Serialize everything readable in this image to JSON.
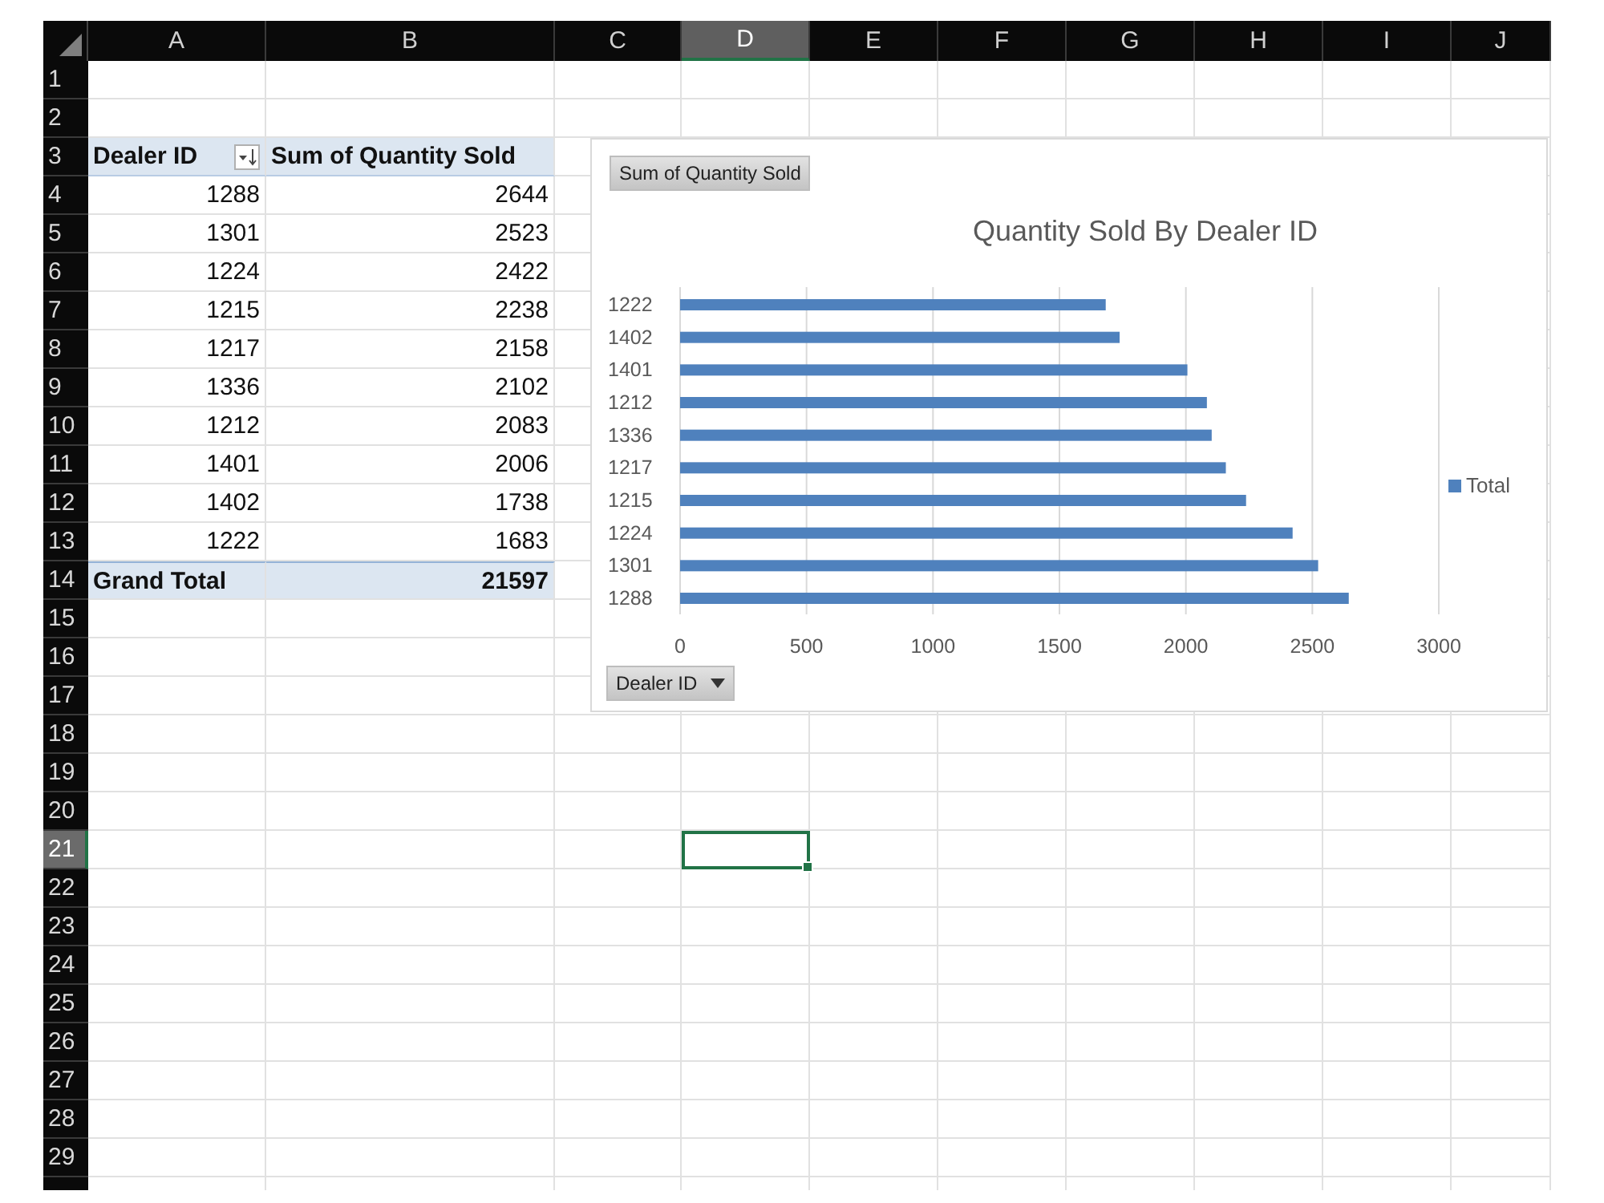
{
  "column_headers": [
    {
      "label": "A",
      "selected": false
    },
    {
      "label": "B",
      "selected": false
    },
    {
      "label": "C",
      "selected": false
    },
    {
      "label": "D",
      "selected": true
    },
    {
      "label": "E",
      "selected": false
    },
    {
      "label": "F",
      "selected": false
    },
    {
      "label": "G",
      "selected": false
    },
    {
      "label": "H",
      "selected": false
    },
    {
      "label": "I",
      "selected": false
    },
    {
      "label": "J",
      "selected": false
    }
  ],
  "row_headers": [
    {
      "label": "1",
      "selected": false
    },
    {
      "label": "2",
      "selected": false
    },
    {
      "label": "3",
      "selected": false
    },
    {
      "label": "4",
      "selected": false
    },
    {
      "label": "5",
      "selected": false
    },
    {
      "label": "6",
      "selected": false
    },
    {
      "label": "7",
      "selected": false
    },
    {
      "label": "8",
      "selected": false
    },
    {
      "label": "9",
      "selected": false
    },
    {
      "label": "10",
      "selected": false
    },
    {
      "label": "11",
      "selected": false
    },
    {
      "label": "12",
      "selected": false
    },
    {
      "label": "13",
      "selected": false
    },
    {
      "label": "14",
      "selected": false
    },
    {
      "label": "15",
      "selected": false
    },
    {
      "label": "16",
      "selected": false
    },
    {
      "label": "17",
      "selected": false
    },
    {
      "label": "18",
      "selected": false
    },
    {
      "label": "19",
      "selected": false
    },
    {
      "label": "20",
      "selected": false
    },
    {
      "label": "21",
      "selected": true
    },
    {
      "label": "22",
      "selected": false
    },
    {
      "label": "23",
      "selected": false
    },
    {
      "label": "24",
      "selected": false
    },
    {
      "label": "25",
      "selected": false
    },
    {
      "label": "26",
      "selected": false
    },
    {
      "label": "27",
      "selected": false
    },
    {
      "label": "28",
      "selected": false
    },
    {
      "label": "29",
      "selected": false
    }
  ],
  "pivot_table": {
    "headers": [
      "Dealer ID",
      "Sum of Quantity Sold"
    ],
    "rows": [
      {
        "dealer_id": "1288",
        "quantity": "2644"
      },
      {
        "dealer_id": "1301",
        "quantity": "2523"
      },
      {
        "dealer_id": "1224",
        "quantity": "2422"
      },
      {
        "dealer_id": "1215",
        "quantity": "2238"
      },
      {
        "dealer_id": "1217",
        "quantity": "2158"
      },
      {
        "dealer_id": "1336",
        "quantity": "2102"
      },
      {
        "dealer_id": "1212",
        "quantity": "2083"
      },
      {
        "dealer_id": "1401",
        "quantity": "2006"
      },
      {
        "dealer_id": "1402",
        "quantity": "1738"
      },
      {
        "dealer_id": "1222",
        "quantity": "1683"
      }
    ],
    "total": {
      "label": "Grand Total",
      "value": "21597"
    }
  },
  "chart": {
    "value_field_button": "Sum of Quantity Sold",
    "axis_field_button": "Dealer ID",
    "chart_data": {
      "type": "bar",
      "orientation": "horizontal",
      "title": "Quantity Sold By Dealer ID",
      "categories": [
        "1222",
        "1402",
        "1401",
        "1212",
        "1336",
        "1217",
        "1215",
        "1224",
        "1301",
        "1288"
      ],
      "series": [
        {
          "name": "Total",
          "color": "#4f81bd",
          "values": [
            1683,
            1738,
            2006,
            2083,
            2102,
            2158,
            2238,
            2422,
            2523,
            2644
          ]
        }
      ],
      "xlim": [
        0,
        3000
      ],
      "xticks": [
        0,
        500,
        1000,
        1500,
        2000,
        2500,
        3000
      ],
      "grid": true
    }
  }
}
